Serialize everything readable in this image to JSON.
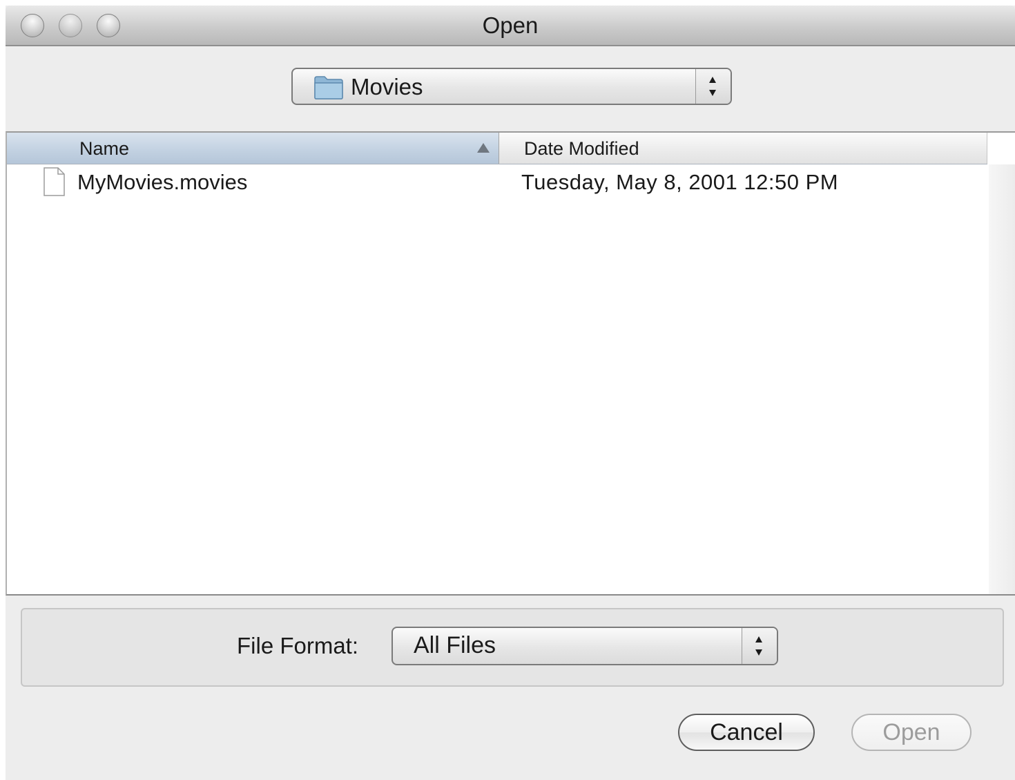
{
  "window": {
    "title": "Open"
  },
  "location": {
    "selected": "Movies",
    "icon": "folder-icon"
  },
  "browser": {
    "columns": {
      "name_label": "Name",
      "date_label": "Date Modified",
      "sort": "ascending"
    },
    "files": [
      {
        "name": "MyMovies.movies",
        "date_modified": "Tuesday, May 8, 2001 12:50 PM",
        "icon": "document-icon"
      }
    ]
  },
  "format": {
    "label": "File Format:",
    "selected": "All Files"
  },
  "buttons": {
    "cancel_label": "Cancel",
    "open_label": "Open",
    "open_enabled": false
  },
  "colors": {
    "window_bg": "#ededed",
    "selected_column_header": "#c3d2e2",
    "disabled_text": "#9c9c9c"
  }
}
